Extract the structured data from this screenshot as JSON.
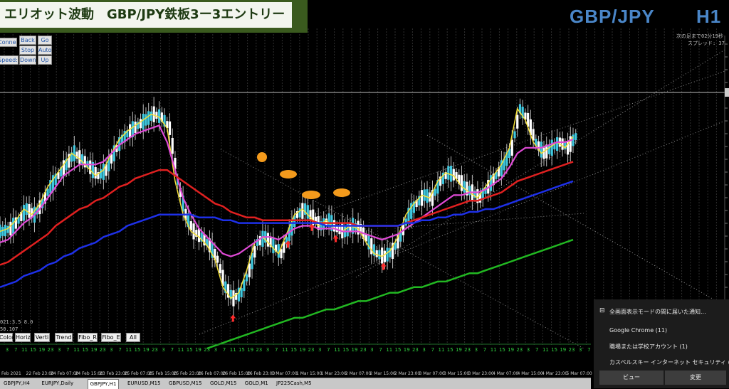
{
  "banner": {
    "title": "エリオット波動　GBP/JPY鉄板3ー3エントリー"
  },
  "symbol": {
    "pair": "GBP/JPY",
    "timeframe": "H1"
  },
  "top_right_info": {
    "line1": "次の足まで02分19秒",
    "line2": "スプレッド: 37"
  },
  "tester_buttons": {
    "connect": "Connect",
    "back": "Back",
    "go": "Go",
    "stop": "Stop",
    "auto": "Auto",
    "speed": "Speed: 1",
    "down": "Down",
    "up": "Up"
  },
  "info_text": {
    "line1": "021:3.5 8.0",
    "line2": "50.107"
  },
  "bottom_buttons": [
    "Color",
    "Horiz",
    "Verti",
    "Trend",
    "Fibo_R",
    "Fibo_E",
    "All"
  ],
  "hour_labels": [
    "3",
    "7",
    "11",
    "15",
    "19",
    "23",
    "3",
    "7",
    "11",
    "15",
    "19",
    "23",
    "3",
    "7",
    "11",
    "15",
    "19",
    "23",
    "3",
    "7",
    "11",
    "15",
    "19",
    "23",
    "3",
    "7",
    "11",
    "15",
    "19",
    "23",
    "3",
    "7",
    "11",
    "15",
    "19",
    "23",
    "3",
    "7",
    "11",
    "15",
    "19",
    "23",
    "3",
    "7",
    "11",
    "15",
    "19",
    "23",
    "3",
    "7",
    "11",
    "15",
    "19",
    "23",
    "3",
    "7",
    "11",
    "15",
    "19",
    "23",
    "3",
    "7",
    "11",
    "15",
    "19",
    "23",
    "3",
    "7",
    "11",
    "15",
    "19",
    "23",
    "3",
    "7",
    "11",
    "15",
    "19",
    "23",
    "3",
    "7",
    "11",
    "15",
    "19",
    "23",
    "3",
    "7",
    "11",
    "15",
    "19",
    "23",
    "3",
    "7",
    "11",
    "15",
    "19",
    "23",
    "3",
    "7",
    "11",
    "15",
    "19",
    "23",
    "3",
    "7",
    "11",
    "15",
    "19",
    "23",
    "3",
    "7",
    "11",
    "15",
    "19",
    "23",
    "3",
    "7",
    "11",
    "15",
    "19",
    "23",
    "3",
    "7",
    "11",
    "15",
    "19",
    "23"
  ],
  "date_labels": [
    "Feb 2021",
    "22 Feb 23:00",
    "24 Feb 07:00",
    "24 Feb 15:00",
    "23 Feb 23:00",
    "25 Feb 07:00",
    "25 Feb 15:00",
    "25 Feb 23:00",
    "26 Feb 07:00",
    "26 Feb 15:00",
    "26 Feb 23:00",
    "1 Mar 07:00",
    "1 Mar 15:00",
    "1 Mar 23:00",
    "2 Mar 07:00",
    "2 Mar 15:00",
    "2 Mar 23:00",
    "3 Mar 07:00",
    "3 Mar 15:00",
    "3 Mar 23:00",
    "4 Mar 07:00",
    "4 Mar 15:00",
    "4 Mar 23:00",
    "5 Mar 07:00"
  ],
  "tabs": {
    "items": [
      "GBPJPY,H4",
      "EURJPY,Daily",
      "GBPJPY,H1",
      "EURUSD,M15",
      "GBPUSD,M15",
      "GOLD,M15",
      "GOLD,M1",
      "JP225Cash,M5"
    ],
    "active_index": 2
  },
  "notification": {
    "title": "全画面表示モードの間に届いた通知...",
    "items": [
      "Google Chrome (11)",
      "職場または学校アカウント (1)",
      "カスペルスキー インターネット セキュリティ (1)"
    ],
    "view_label": "ビュー",
    "dismiss_label": "変更"
  },
  "colors": {
    "background": "#000000",
    "bull": "#3fc9e0",
    "bear": "#ffffff",
    "yellow": "#f5e13a",
    "magenta": "#e04ad6",
    "red": "#e02020",
    "blue": "#1e30e8",
    "green": "#22b822",
    "orange": "#f39a1c",
    "arrow": "#ff2a2a",
    "grid": "#2e2e2e",
    "bottom_grid": "#1f6e2a"
  },
  "chart_data": {
    "type": "candlestick",
    "symbol": "GBP/JPY",
    "timeframe": "H1",
    "series": [
      {
        "name": "yellow",
        "values": [
          0.42,
          0.43,
          0.46,
          0.5,
          0.48,
          0.52,
          0.58,
          0.62,
          0.66,
          0.7,
          0.68,
          0.65,
          0.62,
          0.64,
          0.7,
          0.75,
          0.78,
          0.8,
          0.82,
          0.84,
          0.83,
          0.79,
          0.6,
          0.48,
          0.42,
          0.4,
          0.37,
          0.32,
          0.22,
          0.18,
          0.2,
          0.28,
          0.38,
          0.4,
          0.37,
          0.34,
          0.41,
          0.48,
          0.5,
          0.47,
          0.44,
          0.46,
          0.43,
          0.42,
          0.44,
          0.43,
          0.38,
          0.34,
          0.33,
          0.35,
          0.4,
          0.48,
          0.52,
          0.55,
          0.54,
          0.6,
          0.63,
          0.62,
          0.58,
          0.56,
          0.54,
          0.58,
          0.62,
          0.66,
          0.72,
          0.86,
          0.82,
          0.74,
          0.7,
          0.72,
          0.74,
          0.72,
          0.76
        ]
      },
      {
        "name": "magenta",
        "values": [
          0.38,
          0.39,
          0.42,
          0.45,
          0.47,
          0.5,
          0.54,
          0.58,
          0.62,
          0.64,
          0.66,
          0.66,
          0.66,
          0.67,
          0.7,
          0.73,
          0.75,
          0.77,
          0.78,
          0.79,
          0.8,
          0.74,
          0.64,
          0.54,
          0.48,
          0.43,
          0.4,
          0.37,
          0.34,
          0.33,
          0.34,
          0.36,
          0.38,
          0.4,
          0.4,
          0.39,
          0.41,
          0.43,
          0.44,
          0.44,
          0.43,
          0.43,
          0.43,
          0.42,
          0.42,
          0.42,
          0.41,
          0.4,
          0.39,
          0.4,
          0.41,
          0.43,
          0.45,
          0.47,
          0.49,
          0.51,
          0.53,
          0.55,
          0.55,
          0.56,
          0.56,
          0.57,
          0.59,
          0.61,
          0.65,
          0.7,
          0.72,
          0.72,
          0.72,
          0.73,
          0.74,
          0.74,
          0.75
        ]
      },
      {
        "name": "red",
        "values": [
          0.3,
          0.31,
          0.33,
          0.35,
          0.37,
          0.39,
          0.41,
          0.44,
          0.46,
          0.48,
          0.5,
          0.51,
          0.53,
          0.54,
          0.56,
          0.58,
          0.59,
          0.61,
          0.62,
          0.63,
          0.64,
          0.64,
          0.62,
          0.6,
          0.58,
          0.56,
          0.54,
          0.52,
          0.51,
          0.49,
          0.48,
          0.47,
          0.47,
          0.46,
          0.46,
          0.46,
          0.46,
          0.46,
          0.46,
          0.46,
          0.45,
          0.45,
          0.45,
          0.45,
          0.45,
          0.44,
          0.44,
          0.44,
          0.44,
          0.44,
          0.44,
          0.45,
          0.46,
          0.47,
          0.48,
          0.49,
          0.5,
          0.51,
          0.52,
          0.53,
          0.53,
          0.54,
          0.55,
          0.56,
          0.58,
          0.6,
          0.61,
          0.62,
          0.63,
          0.64,
          0.65,
          0.66,
          0.67
        ]
      },
      {
        "name": "blue",
        "values": [
          0.22,
          0.23,
          0.24,
          0.26,
          0.27,
          0.28,
          0.3,
          0.31,
          0.33,
          0.34,
          0.36,
          0.37,
          0.38,
          0.4,
          0.41,
          0.42,
          0.44,
          0.45,
          0.46,
          0.47,
          0.48,
          0.48,
          0.48,
          0.48,
          0.48,
          0.47,
          0.47,
          0.47,
          0.46,
          0.46,
          0.45,
          0.45,
          0.45,
          0.45,
          0.45,
          0.45,
          0.45,
          0.45,
          0.45,
          0.45,
          0.45,
          0.44,
          0.44,
          0.44,
          0.44,
          0.44,
          0.44,
          0.44,
          0.44,
          0.44,
          0.44,
          0.45,
          0.45,
          0.46,
          0.46,
          0.47,
          0.47,
          0.48,
          0.48,
          0.49,
          0.49,
          0.5,
          0.5,
          0.51,
          0.52,
          0.53,
          0.54,
          0.55,
          0.56,
          0.57,
          0.58,
          0.59,
          0.6
        ]
      },
      {
        "name": "green",
        "values": [
          0.0,
          0.0,
          0.0,
          0.0,
          0.0,
          0.0,
          0.0,
          0.0,
          0.0,
          0.0,
          0.0,
          0.0,
          0.0,
          0.0,
          0.0,
          0.0,
          0.0,
          0.0,
          0.0,
          0.0,
          0.0,
          0.0,
          0.0,
          0.0,
          0.0,
          0.0,
          0.0,
          0.01,
          0.02,
          0.03,
          0.04,
          0.05,
          0.06,
          0.07,
          0.08,
          0.09,
          0.1,
          0.11,
          0.11,
          0.12,
          0.13,
          0.14,
          0.14,
          0.15,
          0.16,
          0.17,
          0.17,
          0.18,
          0.19,
          0.2,
          0.2,
          0.21,
          0.22,
          0.22,
          0.23,
          0.24,
          0.24,
          0.25,
          0.26,
          0.27,
          0.27,
          0.28,
          0.29,
          0.3,
          0.31,
          0.32,
          0.33,
          0.34,
          0.35,
          0.36,
          0.37,
          0.38,
          0.39
        ]
      }
    ],
    "sell_arrows_index": [
      36,
      39,
      42,
      48
    ],
    "buy_arrow_index": [
      29
    ]
  }
}
